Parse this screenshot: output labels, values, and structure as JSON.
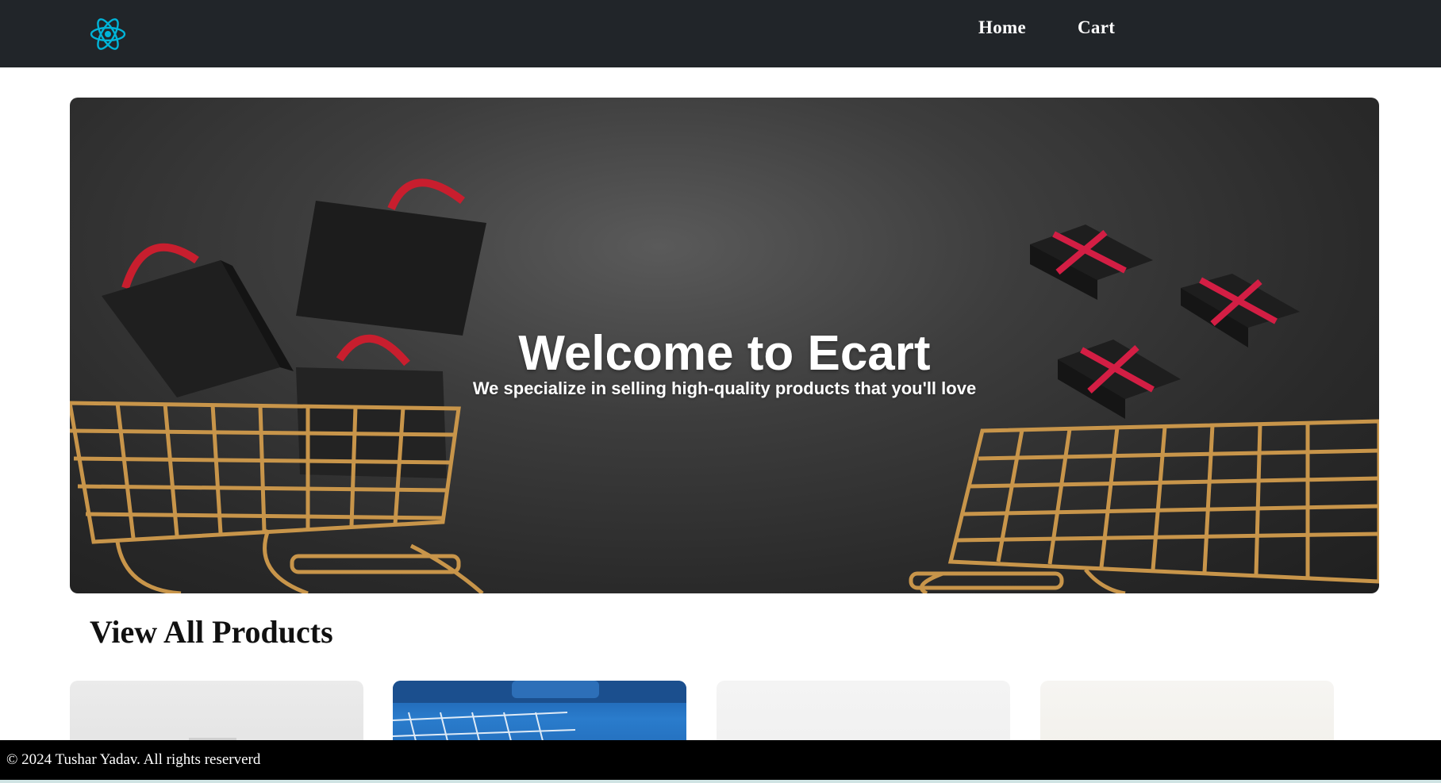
{
  "navbar": {
    "logo_icon": "react-atom-icon",
    "links": [
      {
        "label": "Home"
      },
      {
        "label": "Cart"
      }
    ]
  },
  "hero": {
    "title": "Welcome to Ecart",
    "subtitle": "We specialize in selling high-quality products that you'll love",
    "image": "shopping-carts-bags-gifts-banner"
  },
  "products_section": {
    "title": "View All Products",
    "cards": [
      {
        "image": "product-image-1"
      },
      {
        "image": "product-image-2"
      },
      {
        "image": "product-image-3"
      },
      {
        "image": "product-image-4"
      }
    ]
  },
  "footer": {
    "text": "© 2024 Tushar Yadav. All rights reserverd"
  },
  "colors": {
    "navbar_bg": "#212529",
    "logo_accent": "#00b4d8",
    "footer_bg": "#000000",
    "text_light": "#ffffff"
  }
}
